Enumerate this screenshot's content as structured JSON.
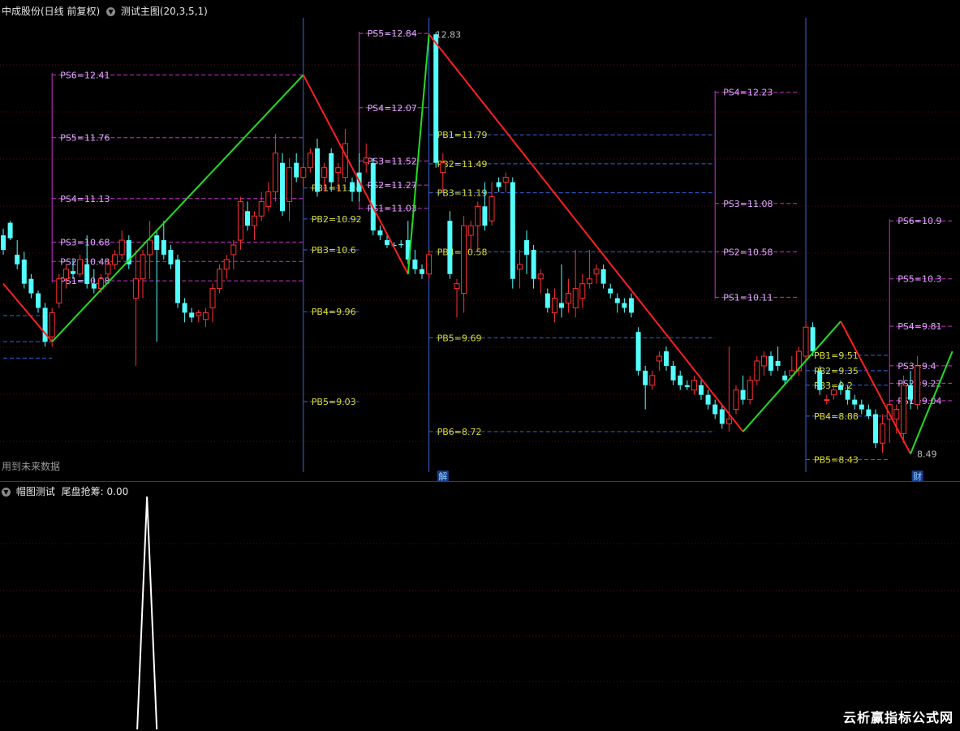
{
  "header": {
    "stock": "中成股份(日线 前复权)",
    "indicator": "测试主图(20,3,5,1)"
  },
  "note": "用到未来数据",
  "subheader": {
    "name": "帽图测试",
    "label": "尾盘抢筹: 0.00"
  },
  "watermark": "云析赢指标公式网",
  "chart_data": [
    {
      "type": "candlestick",
      "title": "",
      "ylim": [
        8.3,
        13.0
      ],
      "colors": {
        "up": "#ff3030",
        "down": "#54ffff",
        "rise_line": "#22dd22",
        "fall_line": "#ff2020",
        "pb": "#3366dd",
        "ps": "#cc33cc",
        "label_pb": "#dddd33",
        "label_ps": "#e0a8ff"
      },
      "candles": [
        {
          "o": 10.75,
          "h": 10.82,
          "l": 10.55,
          "c": 10.6
        },
        {
          "o": 10.88,
          "h": 10.9,
          "l": 10.7,
          "c": 10.72
        },
        {
          "o": 10.55,
          "h": 10.7,
          "l": 10.4,
          "c": 10.45
        },
        {
          "o": 10.5,
          "h": 10.58,
          "l": 10.2,
          "c": 10.25
        },
        {
          "o": 10.3,
          "h": 10.35,
          "l": 10.1,
          "c": 10.15
        },
        {
          "o": 10.15,
          "h": 10.18,
          "l": 9.95,
          "c": 10.0
        },
        {
          "o": 10.0,
          "h": 10.05,
          "l": 9.6,
          "c": 9.65
        },
        {
          "o": 9.7,
          "h": 10.0,
          "l": 9.6,
          "c": 9.95
        },
        {
          "o": 10.05,
          "h": 10.35,
          "l": 10.0,
          "c": 10.3
        },
        {
          "o": 10.3,
          "h": 10.45,
          "l": 10.2,
          "c": 10.4
        },
        {
          "o": 10.38,
          "h": 10.5,
          "l": 10.3,
          "c": 10.35
        },
        {
          "o": 10.35,
          "h": 10.55,
          "l": 10.32,
          "c": 10.5
        },
        {
          "o": 10.45,
          "h": 10.75,
          "l": 10.2,
          "c": 10.25
        },
        {
          "o": 10.25,
          "h": 10.4,
          "l": 10.15,
          "c": 10.2
        },
        {
          "o": 10.2,
          "h": 10.35,
          "l": 10.15,
          "c": 10.3
        },
        {
          "o": 10.35,
          "h": 10.5,
          "l": 10.3,
          "c": 10.45
        },
        {
          "o": 10.45,
          "h": 10.6,
          "l": 10.4,
          "c": 10.55
        },
        {
          "o": 10.55,
          "h": 10.8,
          "l": 10.5,
          "c": 10.7
        },
        {
          "o": 10.7,
          "h": 10.75,
          "l": 10.4,
          "c": 10.45
        },
        {
          "o": 10.1,
          "h": 10.6,
          "l": 9.4,
          "c": 10.3
        },
        {
          "o": 10.3,
          "h": 10.6,
          "l": 10.1,
          "c": 10.55
        },
        {
          "o": 10.55,
          "h": 10.9,
          "l": 10.3,
          "c": 10.7
        },
        {
          "o": 10.75,
          "h": 10.8,
          "l": 9.65,
          "c": 10.6
        },
        {
          "o": 10.7,
          "h": 10.9,
          "l": 10.5,
          "c": 10.55
        },
        {
          "o": 10.6,
          "h": 10.65,
          "l": 10.4,
          "c": 10.45
        },
        {
          "o": 10.5,
          "h": 10.55,
          "l": 10.0,
          "c": 10.05
        },
        {
          "o": 10.05,
          "h": 10.1,
          "l": 9.85,
          "c": 9.95
        },
        {
          "o": 9.95,
          "h": 10.0,
          "l": 9.85,
          "c": 9.9
        },
        {
          "o": 9.92,
          "h": 9.98,
          "l": 9.85,
          "c": 9.95
        },
        {
          "o": 9.88,
          "h": 10.0,
          "l": 9.8,
          "c": 9.95
        },
        {
          "o": 10.0,
          "h": 10.25,
          "l": 9.85,
          "c": 10.2
        },
        {
          "o": 10.2,
          "h": 10.45,
          "l": 10.15,
          "c": 10.4
        },
        {
          "o": 10.4,
          "h": 10.55,
          "l": 10.3,
          "c": 10.5
        },
        {
          "o": 10.55,
          "h": 10.7,
          "l": 10.4,
          "c": 10.65
        },
        {
          "o": 10.7,
          "h": 11.15,
          "l": 10.6,
          "c": 11.1
        },
        {
          "o": 11.0,
          "h": 11.1,
          "l": 10.8,
          "c": 10.85
        },
        {
          "o": 10.85,
          "h": 11.0,
          "l": 10.7,
          "c": 10.95
        },
        {
          "o": 10.95,
          "h": 11.2,
          "l": 10.9,
          "c": 11.1
        },
        {
          "o": 11.05,
          "h": 11.3,
          "l": 11.0,
          "c": 11.2
        },
        {
          "o": 11.2,
          "h": 11.8,
          "l": 11.1,
          "c": 11.6
        },
        {
          "o": 11.5,
          "h": 11.6,
          "l": 10.95,
          "c": 11.0
        },
        {
          "o": 11.1,
          "h": 11.55,
          "l": 10.9,
          "c": 11.45
        },
        {
          "o": 11.5,
          "h": 11.6,
          "l": 11.3,
          "c": 11.35
        },
        {
          "o": 11.35,
          "h": 11.5,
          "l": 11.25,
          "c": 11.45
        },
        {
          "o": 11.45,
          "h": 11.65,
          "l": 11.4,
          "c": 11.6
        },
        {
          "o": 11.65,
          "h": 11.75,
          "l": 11.15,
          "c": 11.2
        },
        {
          "o": 11.35,
          "h": 11.5,
          "l": 11.2,
          "c": 11.45
        },
        {
          "o": 11.6,
          "h": 11.65,
          "l": 11.2,
          "c": 11.3
        },
        {
          "o": 11.4,
          "h": 11.5,
          "l": 11.2,
          "c": 11.45
        },
        {
          "o": 11.35,
          "h": 11.85,
          "l": 11.3,
          "c": 11.7
        },
        {
          "o": 11.3,
          "h": 11.35,
          "l": 11.1,
          "c": 11.2
        },
        {
          "o": 11.4,
          "h": 11.6,
          "l": 11.1,
          "c": 11.2
        },
        {
          "o": 11.5,
          "h": 11.7,
          "l": 11.4,
          "c": 11.55
        },
        {
          "o": 11.5,
          "h": 11.55,
          "l": 10.75,
          "c": 10.8
        },
        {
          "o": 10.8,
          "h": 10.85,
          "l": 10.7,
          "c": 10.75
        },
        {
          "o": 10.7,
          "h": 10.75,
          "l": 10.62,
          "c": 10.65
        },
        {
          "o": 10.65,
          "h": 10.68,
          "l": 10.62,
          "c": 10.64
        },
        {
          "o": 10.66,
          "h": 10.7,
          "l": 10.62,
          "c": 10.65
        },
        {
          "o": 10.7,
          "h": 10.9,
          "l": 10.45,
          "c": 10.5
        },
        {
          "o": 10.5,
          "h": 10.6,
          "l": 10.35,
          "c": 10.4
        },
        {
          "o": 10.4,
          "h": 10.45,
          "l": 10.3,
          "c": 10.35
        },
        {
          "o": 10.35,
          "h": 10.6,
          "l": 10.3,
          "c": 10.55
        },
        {
          "o": 12.83,
          "h": 12.85,
          "l": 11.45,
          "c": 11.5
        },
        {
          "o": 11.4,
          "h": 11.6,
          "l": 11.2,
          "c": 11.5
        },
        {
          "o": 10.9,
          "h": 11.0,
          "l": 10.3,
          "c": 10.35
        },
        {
          "o": 10.2,
          "h": 10.3,
          "l": 9.9,
          "c": 10.25
        },
        {
          "o": 10.15,
          "h": 10.95,
          "l": 9.95,
          "c": 10.85
        },
        {
          "o": 10.75,
          "h": 10.9,
          "l": 10.6,
          "c": 10.85
        },
        {
          "o": 10.85,
          "h": 11.1,
          "l": 10.6,
          "c": 11.05
        },
        {
          "o": 11.05,
          "h": 11.3,
          "l": 10.8,
          "c": 10.85
        },
        {
          "o": 10.9,
          "h": 11.3,
          "l": 10.85,
          "c": 11.15
        },
        {
          "o": 11.3,
          "h": 11.35,
          "l": 11.2,
          "c": 11.25
        },
        {
          "o": 11.3,
          "h": 11.4,
          "l": 11.2,
          "c": 11.35
        },
        {
          "o": 11.3,
          "h": 11.35,
          "l": 10.2,
          "c": 10.3
        },
        {
          "o": 10.4,
          "h": 10.6,
          "l": 10.2,
          "c": 10.45
        },
        {
          "o": 10.7,
          "h": 10.8,
          "l": 10.35,
          "c": 10.55
        },
        {
          "o": 10.6,
          "h": 10.65,
          "l": 10.2,
          "c": 10.3
        },
        {
          "o": 10.3,
          "h": 10.4,
          "l": 10.15,
          "c": 10.35
        },
        {
          "o": 10.15,
          "h": 10.2,
          "l": 9.95,
          "c": 10.0
        },
        {
          "o": 9.95,
          "h": 10.2,
          "l": 9.85,
          "c": 10.1
        },
        {
          "o": 10.05,
          "h": 10.45,
          "l": 9.9,
          "c": 10.0
        },
        {
          "o": 10.05,
          "h": 10.3,
          "l": 9.95,
          "c": 10.15
        },
        {
          "o": 10.0,
          "h": 10.6,
          "l": 9.9,
          "c": 10.2
        },
        {
          "o": 10.1,
          "h": 10.35,
          "l": 10.0,
          "c": 10.25
        },
        {
          "o": 10.25,
          "h": 10.6,
          "l": 10.2,
          "c": 10.3
        },
        {
          "o": 10.35,
          "h": 10.45,
          "l": 10.25,
          "c": 10.4
        },
        {
          "o": 10.4,
          "h": 10.45,
          "l": 10.2,
          "c": 10.25
        },
        {
          "o": 10.2,
          "h": 10.25,
          "l": 10.1,
          "c": 10.15
        },
        {
          "o": 10.1,
          "h": 10.15,
          "l": 9.95,
          "c": 10.05
        },
        {
          "o": 10.05,
          "h": 10.1,
          "l": 9.95,
          "c": 10.0
        },
        {
          "o": 10.1,
          "h": 10.15,
          "l": 9.9,
          "c": 9.95
        },
        {
          "o": 9.75,
          "h": 9.8,
          "l": 9.3,
          "c": 9.35
        },
        {
          "o": 9.35,
          "h": 9.4,
          "l": 8.95,
          "c": 9.2
        },
        {
          "o": 9.2,
          "h": 9.35,
          "l": 9.15,
          "c": 9.3
        },
        {
          "o": 9.45,
          "h": 9.55,
          "l": 9.35,
          "c": 9.5
        },
        {
          "o": 9.55,
          "h": 9.6,
          "l": 9.35,
          "c": 9.4
        },
        {
          "o": 9.4,
          "h": 9.45,
          "l": 9.2,
          "c": 9.25
        },
        {
          "o": 9.3,
          "h": 9.35,
          "l": 9.15,
          "c": 9.2
        },
        {
          "o": 9.2,
          "h": 9.25,
          "l": 9.15,
          "c": 9.18
        },
        {
          "o": 9.15,
          "h": 9.3,
          "l": 9.1,
          "c": 9.25
        },
        {
          "o": 9.2,
          "h": 9.25,
          "l": 9.05,
          "c": 9.1
        },
        {
          "o": 9.1,
          "h": 9.15,
          "l": 8.95,
          "c": 9.0
        },
        {
          "o": 9.0,
          "h": 9.05,
          "l": 8.85,
          "c": 8.9
        },
        {
          "o": 8.95,
          "h": 9.0,
          "l": 8.75,
          "c": 8.8
        },
        {
          "o": 8.8,
          "h": 9.6,
          "l": 8.72,
          "c": 8.85
        },
        {
          "o": 8.95,
          "h": 9.2,
          "l": 8.9,
          "c": 9.15
        },
        {
          "o": 9.15,
          "h": 9.3,
          "l": 9.0,
          "c": 9.05
        },
        {
          "o": 9.05,
          "h": 9.3,
          "l": 9.0,
          "c": 9.25
        },
        {
          "o": 9.25,
          "h": 9.5,
          "l": 9.2,
          "c": 9.45
        },
        {
          "o": 9.4,
          "h": 9.55,
          "l": 9.3,
          "c": 9.5
        },
        {
          "o": 9.5,
          "h": 9.55,
          "l": 9.3,
          "c": 9.35
        },
        {
          "o": 9.45,
          "h": 9.6,
          "l": 9.35,
          "c": 9.4
        },
        {
          "o": 9.3,
          "h": 9.35,
          "l": 9.2,
          "c": 9.25
        },
        {
          "o": 9.3,
          "h": 9.5,
          "l": 9.25,
          "c": 9.35
        },
        {
          "o": 9.35,
          "h": 9.6,
          "l": 9.3,
          "c": 9.55
        },
        {
          "o": 9.5,
          "h": 9.85,
          "l": 9.45,
          "c": 9.8
        },
        {
          "o": 9.8,
          "h": 9.85,
          "l": 9.5,
          "c": 9.55
        },
        {
          "o": 9.35,
          "h": 9.4,
          "l": 9.1,
          "c": 9.15
        },
        {
          "o": 9.05,
          "h": 9.1,
          "l": 9.0,
          "c": 9.05
        },
        {
          "o": 9.1,
          "h": 9.2,
          "l": 9.05,
          "c": 9.15
        },
        {
          "o": 9.2,
          "h": 9.25,
          "l": 9.1,
          "c": 9.15
        },
        {
          "o": 9.15,
          "h": 9.2,
          "l": 9.0,
          "c": 9.05
        },
        {
          "o": 9.05,
          "h": 9.1,
          "l": 8.95,
          "c": 9.0
        },
        {
          "o": 9.0,
          "h": 9.05,
          "l": 8.9,
          "c": 8.95
        },
        {
          "o": 8.95,
          "h": 9.0,
          "l": 8.85,
          "c": 8.88
        },
        {
          "o": 8.9,
          "h": 8.95,
          "l": 8.55,
          "c": 8.6
        },
        {
          "o": 8.6,
          "h": 8.9,
          "l": 8.5,
          "c": 8.8
        },
        {
          "o": 8.85,
          "h": 9.05,
          "l": 8.6,
          "c": 9.0
        },
        {
          "o": 8.85,
          "h": 9.0,
          "l": 8.7,
          "c": 8.95
        },
        {
          "o": 8.7,
          "h": 9.3,
          "l": 8.6,
          "c": 9.2
        },
        {
          "o": 9.2,
          "h": 9.35,
          "l": 8.95,
          "c": 9.05
        },
        {
          "o": 9.0,
          "h": 9.5,
          "l": 8.95,
          "c": 9.4
        }
      ],
      "zigzag": [
        {
          "i": 0,
          "p": 10.25,
          "dir": "fall"
        },
        {
          "i": 7,
          "p": 9.65,
          "dir": "rise"
        },
        {
          "i": 43,
          "p": 12.41,
          "dir": "fall"
        },
        {
          "i": 58,
          "p": 10.35,
          "dir": "rise"
        },
        {
          "i": 61,
          "p": 12.83,
          "dir": "fall"
        },
        {
          "i": 106,
          "p": 8.72,
          "dir": "rise"
        },
        {
          "i": 120,
          "p": 9.86,
          "dir": "fall"
        },
        {
          "i": 130,
          "p": 8.49,
          "dir": "rise"
        },
        {
          "i": 136,
          "p": 9.55,
          "dir": "end"
        }
      ],
      "levels": [
        {
          "group": "ps",
          "x0": 7,
          "x1": 43,
          "values": [
            [
              "PS6=12.41",
              12.41
            ],
            [
              "PS5=11.76",
              11.76
            ],
            [
              "PS4=11.13",
              11.13
            ],
            [
              "PS3=10.68",
              10.68
            ],
            [
              "PS2=10.48",
              10.48
            ],
            [
              "PS1=10.28",
              10.28
            ]
          ]
        },
        {
          "group": "ps",
          "x0": 51,
          "x1": 61,
          "values": [
            [
              "PS5=12.84",
              12.84
            ],
            [
              "PS4=12.07",
              12.07
            ],
            [
              "PS3=11.52",
              11.52
            ],
            [
              "PS2=11.27",
              11.27
            ],
            [
              "PS1=11.03",
              11.03
            ]
          ]
        },
        {
          "group": "ps",
          "x0": 102,
          "x1": 114,
          "values": [
            [
              "PS4=12.23",
              12.23
            ],
            [
              "PS3=11.08",
              11.08
            ],
            [
              "PS2=10.58",
              10.58
            ],
            [
              "PS1=10.11",
              10.11
            ]
          ]
        },
        {
          "group": "ps",
          "x0": 127,
          "x1": 136,
          "values": [
            [
              "PS6=10.9",
              10.9
            ],
            [
              "PS5=10.3",
              10.3
            ],
            [
              "PS4=9.81",
              9.81
            ],
            [
              "PS3=9.4",
              9.4
            ],
            [
              "PS2=9.22",
              9.22
            ],
            [
              "PS1=9.04",
              9.04
            ]
          ]
        },
        {
          "group": "pb",
          "x0": 43,
          "x1": 51,
          "values": [
            [
              "PB1=11.24",
              11.24
            ],
            [
              "PB2=10.92",
              10.92
            ],
            [
              "PB3=10.6",
              10.6
            ],
            [
              "PB4=9.96",
              9.96
            ],
            [
              "PB5=9.03",
              9.03
            ]
          ]
        },
        {
          "group": "pb",
          "x0": 61,
          "x1": 102,
          "values": [
            [
              "PB1=11.79",
              11.79
            ],
            [
              "PB2=11.49",
              11.49
            ],
            [
              "PB3=11.19",
              11.19
            ],
            [
              "PB4=10.58",
              10.58
            ],
            [
              "PB5=9.69",
              9.69
            ],
            [
              "PB6=8.72",
              8.72
            ]
          ]
        },
        {
          "group": "pb",
          "x0": 115,
          "x1": 127,
          "values": [
            [
              "PB1=9.51",
              9.51
            ],
            [
              "PB2=9.35",
              9.35
            ],
            [
              "PB3=9.2",
              9.2
            ],
            [
              "PB4=8.88",
              8.88
            ],
            [
              "PB5=8.43",
              8.43
            ]
          ]
        },
        {
          "group": "pb",
          "x0": 0,
          "x1": 7,
          "values": [
            [
              "",
              9.92
            ],
            [
              "",
              9.65
            ],
            [
              "",
              9.48
            ]
          ]
        }
      ],
      "annotations": [
        {
          "i": 61,
          "p": 12.83,
          "text": "12.83"
        },
        {
          "i": 130,
          "p": 8.49,
          "text": "8.49"
        }
      ],
      "markers": [
        {
          "i": 63,
          "text": "解"
        },
        {
          "i": 131,
          "text": "财"
        }
      ]
    },
    {
      "type": "line",
      "title": "",
      "ylim": [
        0,
        1
      ],
      "values": [
        0,
        1,
        0
      ],
      "x": [
        19.2,
        20.6,
        22.0
      ],
      "color": "#ffffff"
    }
  ]
}
